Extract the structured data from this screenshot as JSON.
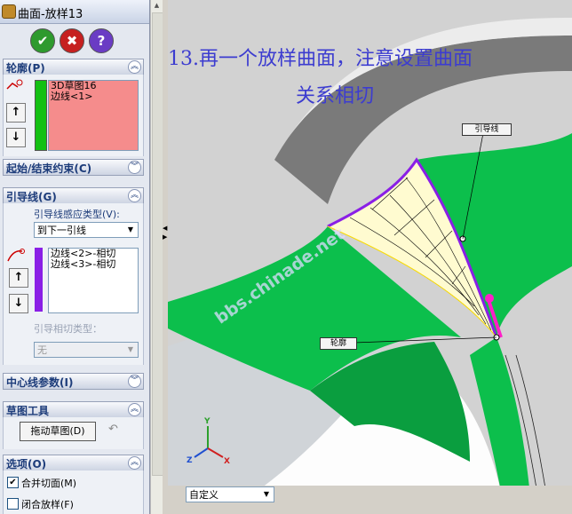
{
  "window": {
    "title": "曲面-放样13"
  },
  "actions": {
    "ok": "✔",
    "cancel": "✖",
    "help": "?"
  },
  "sections": {
    "profile": {
      "title": "轮廓(P)",
      "items": [
        "3D草图16",
        "边线<1>"
      ]
    },
    "start_end": {
      "title": "起始/结束约束(C)"
    },
    "guides": {
      "title": "引导线(G)",
      "influence_label": "引导线感应类型(V):",
      "influence_value": "到下一引线",
      "items": [
        "边线<2>-相切",
        "边线<3>-相切"
      ],
      "tangent_label": "引导相切类型：",
      "tangent_value": "无"
    },
    "centerline": {
      "title": "中心线参数(I)"
    },
    "sketch_tools": {
      "title": "草图工具",
      "drag_button": "拖动草图(D)"
    },
    "options": {
      "title": "选项(O)",
      "merge": {
        "label": "合并切面(M)",
        "checked": true
      },
      "closed": {
        "label": "闭合放样(F)",
        "checked": false
      }
    }
  },
  "viewport": {
    "caption_line1": "13.再一个放样曲面，注意设置曲面",
    "caption_line2": "关系相切",
    "callout_guide": "引导线",
    "callout_profile": "轮廓",
    "watermark": "bbs.chinade.net",
    "triad_labels": [
      "Y",
      "Z",
      "X"
    ],
    "view_orientation": "自定义"
  },
  "colors": {
    "surface_green": "#0cbf4c",
    "loft_fill": "#fffbd0",
    "guide_purple": "#8a1fe6",
    "caption_blue": "#3c3cd0"
  }
}
